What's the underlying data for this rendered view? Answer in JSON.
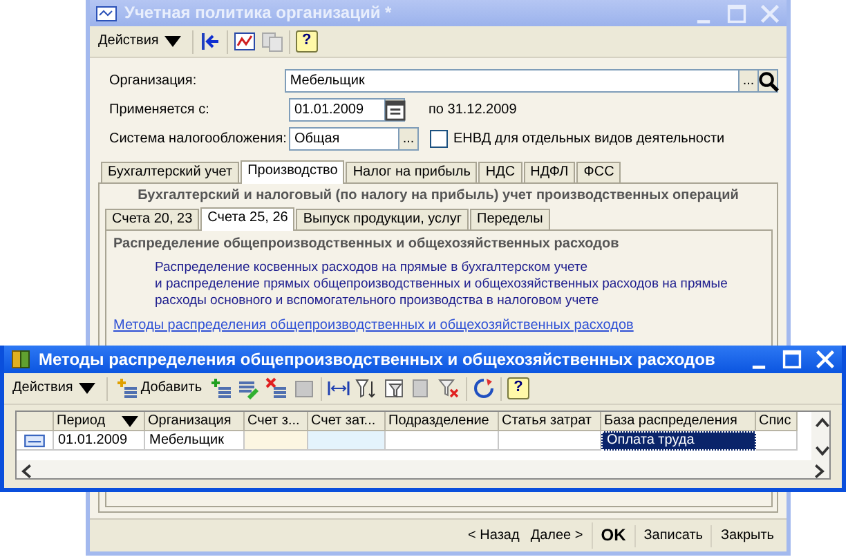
{
  "main_window": {
    "title": "Учетная политика организаций *",
    "toolbar": {
      "actions_label": "Действия",
      "help_label": "?"
    },
    "organization": {
      "label": "Организация:",
      "value": "Мебельщик",
      "choose_label": "..."
    },
    "applies_from": {
      "label": "Применяется с:",
      "value": "01.01.2009",
      "period_end": "по 31.12.2009"
    },
    "tax_system": {
      "label": "Система налогообложения:",
      "value": "Общая",
      "choose_label": "...",
      "envd": {
        "label": "ЕНВД для отдельных видов деятельности",
        "checked": false
      }
    },
    "tabs": [
      {
        "label": "Бухгалтерский учет",
        "selected": false
      },
      {
        "label": "Производство",
        "selected": true
      },
      {
        "label": "Налог на прибыль",
        "selected": false
      },
      {
        "label": "НДС",
        "selected": false
      },
      {
        "label": "НДФЛ",
        "selected": false
      },
      {
        "label": "ФСС",
        "selected": false
      }
    ],
    "group_title": "Бухгалтерский и налоговый (по налогу на прибыль) учет производственных операций",
    "subtabs": [
      {
        "label": "Счета 20, 23",
        "selected": false
      },
      {
        "label": "Счета 25, 26",
        "selected": true
      },
      {
        "label": "Выпуск продукции, услуг",
        "selected": false
      },
      {
        "label": "Переделы",
        "selected": false
      }
    ],
    "section_title": "Распределение общепроизводственных и общехозяйственных расходов",
    "description_lines": [
      "Распределение косвенных расходов на прямые в бухгалтерском учете",
      "и распределение прямых общепроизводственных и общехозяйственных расходов на прямые",
      "расходы основного и вспомогательного производства в налоговом учете"
    ],
    "link": "Методы распределения общепроизводственных и общехозяйственных расходов",
    "footer": {
      "back": "< Назад",
      "next": "Далее >",
      "ok": "OK",
      "save": "Записать",
      "close": "Закрыть"
    }
  },
  "list_window": {
    "title": "Методы распределения общепроизводственных и общехозяйственных расходов",
    "toolbar": {
      "actions_label": "Действия",
      "add_label": "Добавить",
      "help_label": "?"
    },
    "columns": [
      {
        "label": "Период",
        "sorted": true
      },
      {
        "label": "Организация",
        "sorted": false
      },
      {
        "label": "Счет з...",
        "sorted": false
      },
      {
        "label": "Счет зат...",
        "sorted": false
      },
      {
        "label": "Подразделение",
        "sorted": false
      },
      {
        "label": "Статья затрат",
        "sorted": false
      },
      {
        "label": "База распределения",
        "sorted": false
      },
      {
        "label": "Спис",
        "sorted": false
      }
    ],
    "rows": [
      {
        "cells": [
          {
            "text": "01.01.2009",
            "selected": false
          },
          {
            "text": "Мебельщик",
            "selected": false
          },
          {
            "color": "#fcf6e2",
            "selected": false
          },
          {
            "color": "#e4f3fc",
            "selected": false
          },
          {
            "selected": false
          },
          {
            "selected": false
          },
          {
            "text": "Оплата труда",
            "selected": true
          },
          {
            "selected": false
          }
        ]
      }
    ]
  }
}
